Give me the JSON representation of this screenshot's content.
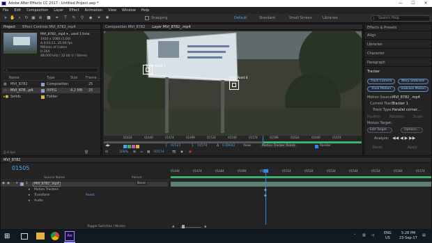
{
  "window": {
    "title": "Adobe After Effects CC 2017 - Untitled Project.aep *",
    "minimize": "—",
    "maximize": "☐",
    "close": "✕"
  },
  "menu": [
    "File",
    "Edit",
    "Composition",
    "Layer",
    "Effect",
    "Animation",
    "View",
    "Window",
    "Help"
  ],
  "toolbar": {
    "snapping": "Snapping",
    "workspaces": [
      "Default",
      "Standard",
      "Small Screen",
      "Libraries"
    ],
    "search_placeholder": "Search Help"
  },
  "project": {
    "tab": "Project",
    "tab2": "Effect Controls MVI_8782_mp4",
    "item_name": "MVI_8782_.mp4 ▾ , used 1 time",
    "info": [
      "1920 x 1080 (1.00)",
      "Δ 0;01;11, 25.00 fps",
      "Millions of Colors",
      "H.264",
      "48.000 kHz / 32 bit U / Stereo"
    ],
    "col_name": "Name",
    "col_type": "Type",
    "col_size": "Size",
    "col_frame": "Frame ...",
    "rows": [
      {
        "name": "MVI_8782",
        "type": "Composition",
        "size": "",
        "frame": "25"
      },
      {
        "name": "MVI_878...p4",
        "type": "MPEG",
        "size": "4.2 MB",
        "frame": "25"
      },
      {
        "name": "Solids",
        "type": "Folder",
        "size": "",
        "frame": ""
      }
    ],
    "bpc": "8 bpc"
  },
  "comp": {
    "tab1": "Composition MVI_8782",
    "tab2": "Layer MVI_8782_.mp4",
    "track_point1": "Track Point 1",
    "track_point2": "Track Point 4",
    "ruler": [
      "01424",
      "01449",
      "01474",
      "01499",
      "01524",
      "01549",
      "01574",
      "01599",
      "01624",
      "01649",
      "01674"
    ],
    "time_in": "01523",
    "time_out": "01574",
    "duration": "0.00042",
    "zoom": "100%",
    "view_label": "View:",
    "view_value": "Motion Tracker Points",
    "render": "Render",
    "timecode": "01574"
  },
  "tracker": {
    "tabs": [
      "Effects & Presets",
      "Align",
      "Libraries",
      "Character",
      "Paragraph"
    ],
    "title": "Tracker",
    "btn_track_camera": "Track Camera",
    "btn_warp": "Warp Stabilizer",
    "btn_track_motion": "Track Motion",
    "btn_stabilize": "Stabilize Motion",
    "motion_source_label": "Motion Source:",
    "motion_source": "MVI_8782_.mp4",
    "current_track_label": "Current Track:",
    "current_track": "Tracker 1",
    "track_type_label": "Track Type:",
    "track_type": "Parallel corner...",
    "position": "Position",
    "rotation": "Rotation",
    "scale": "Scale",
    "motion_target": "Motion Target:",
    "edit_target": "Edit Target...",
    "options": "Options...",
    "analyze": "Analyze:",
    "reset": "Reset",
    "apply": "Apply"
  },
  "timeline": {
    "comp_tab": "MVI_8782",
    "timecode": "01505",
    "layer_num": "1",
    "layer_name": "MVI_8782_.mp4",
    "col_source": "Source Name",
    "col_parent": "Parent",
    "parent_value": "None",
    "sub_rows": [
      "Motion Trackers",
      "Transform",
      "Audio"
    ],
    "reset": "Reset",
    "ruler": [
      "01444",
      "01474",
      "01484",
      "01494",
      "01504",
      "01514",
      "01524",
      "01534",
      "01544",
      "01554",
      "01564",
      "01574"
    ],
    "toggle": "Toggle Switches / Modes"
  },
  "taskbar": {
    "lang": "ENG",
    "region": "US",
    "time": "5:28 PM",
    "date": "23-Sep-17",
    "ae_label": "Ae"
  },
  "colors": {
    "accent": "#2d8ceb",
    "timeline_green": "#3cb371",
    "layer_bar": "#7b9a8f",
    "track_box": "#ffffff"
  }
}
